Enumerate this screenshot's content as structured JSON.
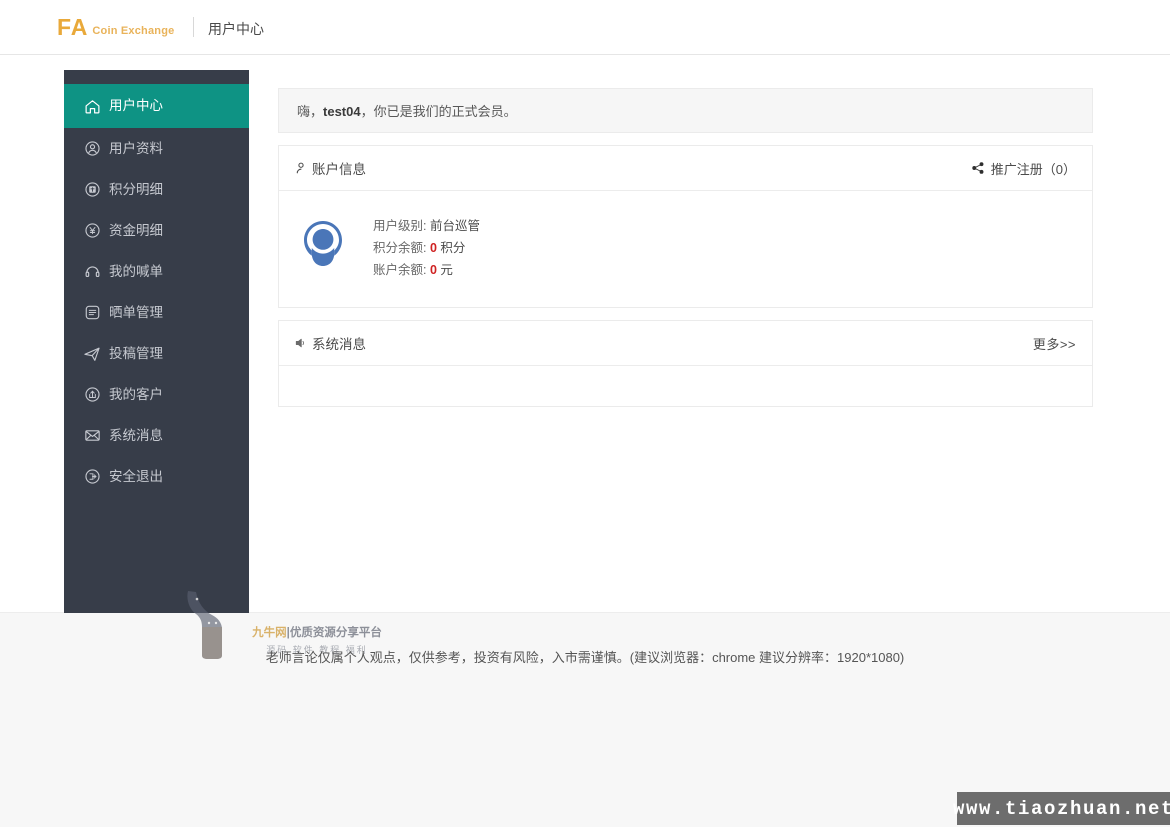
{
  "topbar": {
    "brand_main": "FA",
    "brand_sub": "Coin Exchange",
    "title": "用户中心"
  },
  "sidebar": {
    "items": [
      {
        "label": "用户中心",
        "icon": "home-icon",
        "active": true
      },
      {
        "label": "用户资料",
        "icon": "user-circle-icon",
        "active": false
      },
      {
        "label": "积分明细",
        "icon": "points-circle-icon",
        "active": false
      },
      {
        "label": "资金明细",
        "icon": "yen-circle-icon",
        "active": false
      },
      {
        "label": "我的喊单",
        "icon": "megaphone-icon",
        "active": false
      },
      {
        "label": "晒单管理",
        "icon": "list-square-icon",
        "active": false
      },
      {
        "label": "投稿管理",
        "icon": "paper-plane-icon",
        "active": false
      },
      {
        "label": "我的客户",
        "icon": "share-circle-icon",
        "active": false
      },
      {
        "label": "系统消息",
        "icon": "envelope-icon",
        "active": false
      },
      {
        "label": "安全退出",
        "icon": "logout-circle-icon",
        "active": false
      }
    ]
  },
  "main": {
    "greeting_prefix": "嗨，",
    "greeting_user": "test04",
    "greeting_suffix": "，你已是我们的正式会员。",
    "account_card": {
      "title": "账户信息",
      "title_icon": "person-icon",
      "promo_label": "推广注册（0）",
      "promo_icon": "share-icon",
      "rows": [
        {
          "label": "用户级别:",
          "value": "前台巡管",
          "unit": "",
          "highlight": false
        },
        {
          "label": "积分余额:",
          "value": "0",
          "unit": "积分",
          "highlight": true
        },
        {
          "label": "账户余额:",
          "value": "0",
          "unit": "元",
          "highlight": true
        }
      ]
    },
    "message_card": {
      "title": "系统消息",
      "title_icon": "speaker-icon",
      "more_label": "更多>>"
    }
  },
  "watermark": {
    "brand": "九牛网",
    "tagline": "|优质资源分享平台",
    "sub": "源码 软件 教程 福利"
  },
  "footer": {
    "disclaimer": "老师言论仅属个人观点，仅供参考，投资有风险，入市需谨慎。(建议浏览器：chrome 建议分辨率：1920*1080)"
  },
  "stamp": {
    "url": "www.tiaozhuan.net"
  },
  "colors": {
    "brand_gold": "#e9a93a",
    "sidebar_bg": "#373d49",
    "active_teal": "#0e9384",
    "avatar_blue": "#4a76b8",
    "number_red": "#cf2222"
  }
}
